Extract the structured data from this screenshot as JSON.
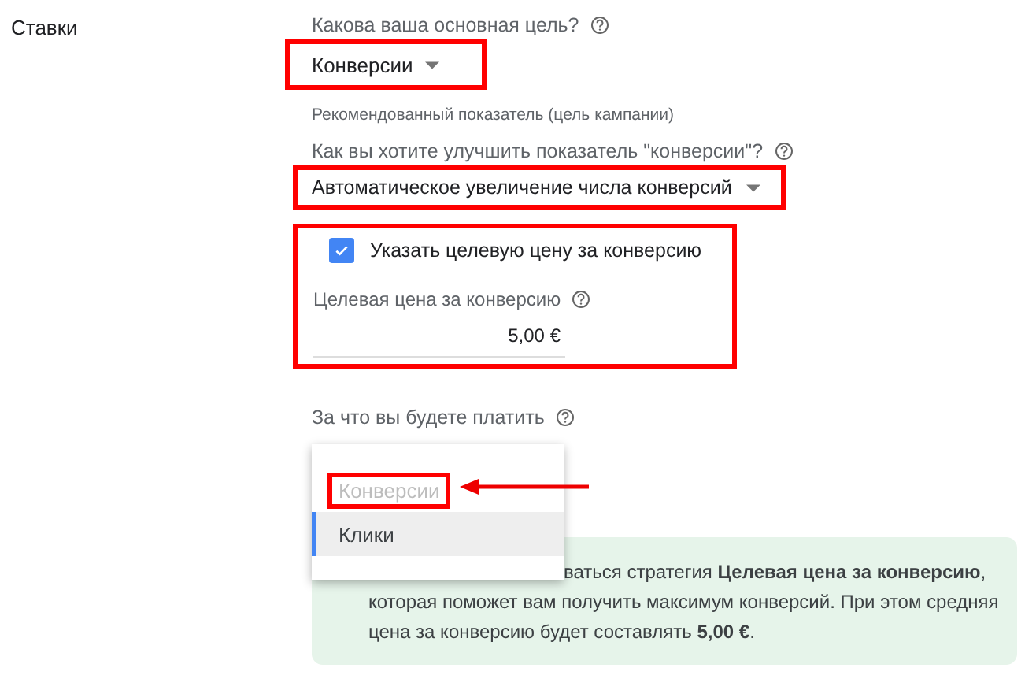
{
  "section": {
    "label": "Ставки"
  },
  "goal": {
    "question": "Какова ваша основная цель?",
    "value": "Конверсии",
    "hint": "Рекомендованный показатель (цель кампании)",
    "highlighted": true
  },
  "improve": {
    "question": "Как вы хотите улучшить показатель \"конверсии\"?",
    "value": "Автоматическое увеличение числа конверсий",
    "highlighted": true
  },
  "target": {
    "highlighted": true,
    "checkbox": {
      "label": "Указать целевую цену за конверсию",
      "checked": true
    },
    "field": {
      "label": "Целевая цена за конверсию",
      "value": "5,00 €"
    }
  },
  "payment": {
    "question": "За что вы будете платить",
    "menu": [
      {
        "label": "Конверсии",
        "selected": false,
        "disabled": true,
        "highlighted": true
      },
      {
        "label": "Клики",
        "selected": true,
        "disabled": false,
        "highlighted": false
      }
    ]
  },
  "info": {
    "text": "ваться стратегия **Целевая цена за конверсию**, которая поможет вам получить максимум конверсий. При этом средняя цена за конверсию будет составлять **5,00 €**."
  }
}
